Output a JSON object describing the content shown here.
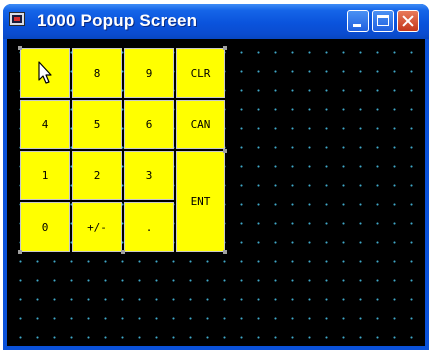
{
  "window": {
    "title": "1000  Popup Screen"
  },
  "keypad": {
    "row1": {
      "k8": "8",
      "k9": "9",
      "clr": "CLR"
    },
    "row2": {
      "k4": "4",
      "k5": "5",
      "k6": "6",
      "can": "CAN"
    },
    "row3": {
      "k1": "1",
      "k2": "2",
      "k3": "3"
    },
    "row4": {
      "k0": "0",
      "plusminus": "+/-",
      "dot": "."
    },
    "ent": "ENT"
  },
  "icons": {
    "app": "app-window-icon",
    "cursor": "arrow-cursor-icon",
    "minimize": "minimize-icon",
    "maximize": "maximize-icon",
    "close": "close-icon"
  },
  "colors": {
    "key_fill": "#ffff00",
    "background": "#000000",
    "grid_dot": "#3fa9c9"
  }
}
